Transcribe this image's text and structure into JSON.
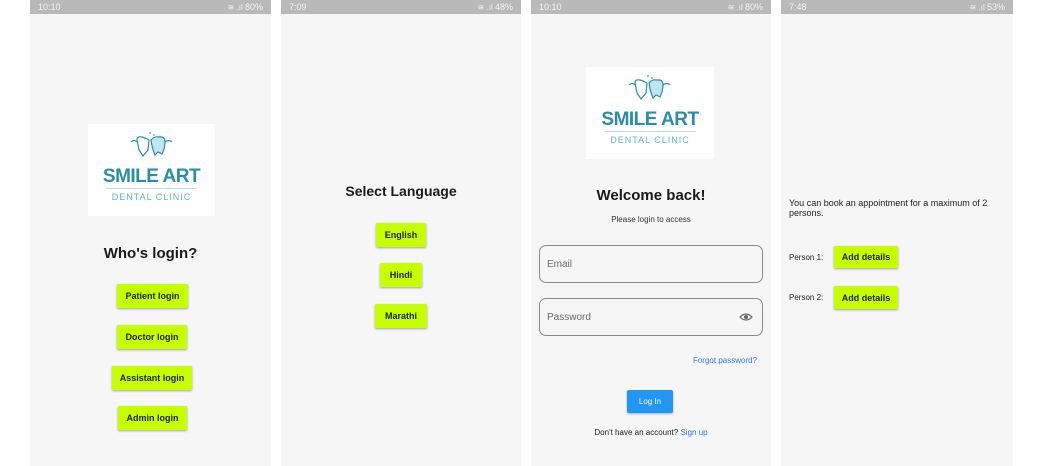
{
  "screens": {
    "s1": {
      "status": {
        "time": "10:10",
        "right": "80%"
      },
      "logo": {
        "title": "SMILE ART",
        "subtitle": "DENTAL CLINIC"
      },
      "heading": "Who's login?",
      "buttons": [
        "Patient login",
        "Doctor login",
        "Assistant login",
        "Admin login"
      ]
    },
    "s2": {
      "status": {
        "time": "7:09",
        "right": "48%"
      },
      "heading": "Select Language",
      "buttons": [
        "English",
        "Hindi",
        "Marathi"
      ]
    },
    "s3": {
      "status": {
        "time": "10:10",
        "right": "80%"
      },
      "logo": {
        "title": "SMILE ART",
        "subtitle": "DENTAL CLINIC"
      },
      "heading": "Welcome back!",
      "subheading": "Please login to access",
      "email_placeholder": "Email",
      "password_placeholder": "Password",
      "forgot": "Forgot password?",
      "login_button": "Log In",
      "signup_prompt": "Don't have an account?",
      "signup_link": "Sign up"
    },
    "s4": {
      "status": {
        "time": "7:48",
        "right": "53%"
      },
      "info": "You can book an appointment for a maximum of 2 persons.",
      "persons": [
        {
          "label": "Person 1:",
          "button": "Add details"
        },
        {
          "label": "Person 2:",
          "button": "Add details"
        }
      ]
    }
  },
  "colors": {
    "accent": "#c6ff00",
    "primary_blue": "#2196f3",
    "link_blue": "#2c7be5",
    "logo_teal": "#2a8ea8"
  }
}
